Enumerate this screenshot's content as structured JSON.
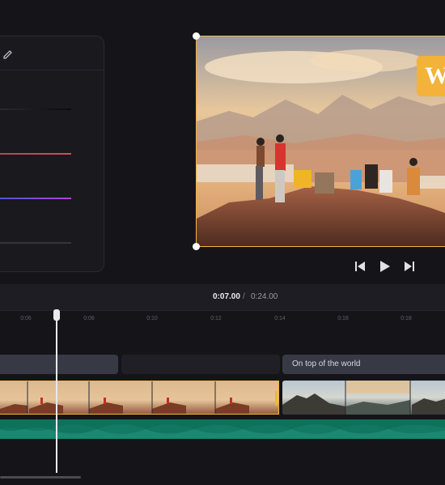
{
  "adjust": {
    "values": [
      "0",
      "0",
      "0",
      "0"
    ],
    "track_colors": [
      "#2c2c32",
      "#c94a5c",
      "#7b3fe0",
      "#34343a"
    ]
  },
  "preview": {
    "watermark_text": "W"
  },
  "playback": {
    "current_time": "0:07.00",
    "separator": "/",
    "total_time": "0:24.00"
  },
  "ruler": {
    "ticks": [
      "0:06",
      "0:08",
      "0:10",
      "0:12",
      "0:14",
      "0:16",
      "0:18"
    ]
  },
  "timeline": {
    "caption2": "On top of the world"
  },
  "colors": {
    "accent": "#f1b53a",
    "audio": "#137a63",
    "caption_bg": "#373a45",
    "background": "#151519"
  },
  "icons": [
    "edit-icon",
    "skip-back-icon",
    "play-icon",
    "skip-forward-icon"
  ]
}
